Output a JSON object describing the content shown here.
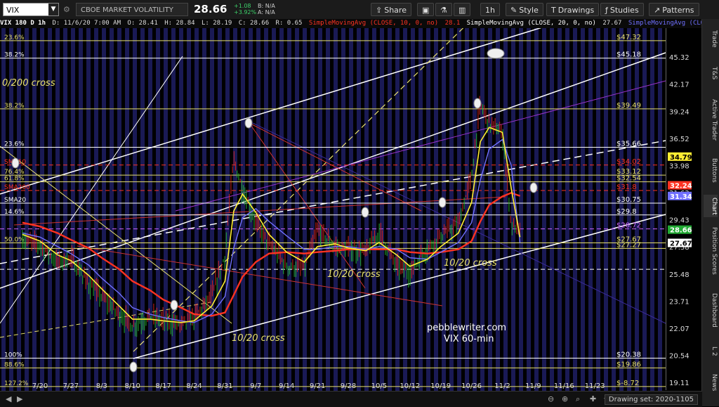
{
  "toolbar": {
    "symbol": "VIX",
    "description": "CBOE MARKET VOLATILITY INDEX",
    "last": "28.66",
    "change": "+1.08",
    "change_pct": "+3.92%",
    "bid": "B: N/A",
    "ask": "A: N/A",
    "share_label": "Share",
    "timeframe": "1h",
    "style_label": "Style",
    "drawings_label": "Drawings",
    "studies_label": "Studies",
    "patterns_label": "Patterns"
  },
  "status_line": {
    "title": "VIX 180 D 1h",
    "date": "D: 11/6/20 7:00 AM",
    "open": "O: 28.41",
    "high": "H: 28.84",
    "low": "L: 28.19",
    "close": "C: 28.66",
    "range": "R: 0.65",
    "sma1": "SimpleMovingAvg (CLOSE, 10, 0, no)",
    "sma1_val": "28.1",
    "sma2": "SimpleMovingAvg (CLOSE, 20, 0, no)",
    "sma2_val": "27.67",
    "sma3": "SimpleMovingAvg (CLOSE, 50,"
  },
  "right_tabs": [
    "Trade",
    "T&S",
    "Active Trader",
    "Buttons",
    "Chart",
    "Position Scores",
    "Dashboard",
    "L 2",
    "News"
  ],
  "drawing_set": "Drawing set: 2020-1105",
  "colors": {
    "background": "#000000",
    "band": "#1a1a55",
    "candle_up": "#22aa33",
    "candle_down": "#cc2222",
    "sma10": "#ffee33",
    "sma20": "#7070ff",
    "sma50": "#ff3322",
    "fib": "#e8e070"
  },
  "chart_data": {
    "type": "line",
    "title": "",
    "ylim": [
      19.11,
      48.2
    ],
    "y_ticks": [
      "45.32",
      "42.17",
      "39.24",
      "36.52",
      "33.98",
      "31.63",
      "29.43",
      "27.38",
      "25.48",
      "23.71",
      "22.07",
      "20.54",
      "19.11"
    ],
    "x_ticks": [
      "7/20",
      "7/27",
      "8/3",
      "8/10",
      "8/17",
      "8/24",
      "8/31",
      "9/7",
      "9/14",
      "9/21",
      "9/28",
      "10/5",
      "10/12",
      "10/19",
      "10/26",
      "11/2",
      "11/9",
      "11/16",
      "11/23"
    ],
    "series": [
      {
        "name": "VIX",
        "x": [
          "7/16",
          "7/20",
          "7/24",
          "7/27",
          "7/31",
          "8/3",
          "8/7",
          "8/10",
          "8/14",
          "8/17",
          "8/21",
          "8/24",
          "8/28",
          "8/31",
          "9/2",
          "9/4",
          "9/7",
          "9/10",
          "9/14",
          "9/18",
          "9/21",
          "9/25",
          "9/28",
          "10/2",
          "10/5",
          "10/9",
          "10/12",
          "10/16",
          "10/19",
          "10/23",
          "10/26",
          "10/28",
          "10/30",
          "11/2",
          "11/4",
          "11/6"
        ],
        "values": [
          28.0,
          27.5,
          26.3,
          26.6,
          24.8,
          24.0,
          22.9,
          22.2,
          22.8,
          22.5,
          22.3,
          22.7,
          24.0,
          26.7,
          34.5,
          31.8,
          29.2,
          27.6,
          26.0,
          25.9,
          28.6,
          27.4,
          27.2,
          27.0,
          28.5,
          26.0,
          25.6,
          27.3,
          28.2,
          29.1,
          33.0,
          40.0,
          38.0,
          37.0,
          29.0,
          28.66
        ]
      },
      {
        "name": "SMA10",
        "values": [
          28.3,
          27.8,
          26.8,
          26.4,
          25.4,
          24.5,
          23.4,
          22.6,
          22.6,
          22.5,
          22.4,
          22.5,
          23.4,
          25.0,
          30.1,
          31.5,
          30.0,
          28.3,
          27.0,
          26.3,
          27.4,
          27.6,
          27.3,
          27.1,
          27.7,
          26.8,
          26.0,
          26.5,
          27.4,
          28.4,
          30.8,
          36.2,
          37.6,
          37.1,
          32.0,
          28.1
        ]
      },
      {
        "name": "SMA20",
        "values": [
          28.4,
          28.1,
          27.4,
          26.9,
          26.1,
          25.2,
          24.2,
          23.3,
          22.9,
          22.7,
          22.5,
          22.4,
          22.9,
          24.0,
          27.3,
          29.6,
          30.3,
          29.3,
          28.2,
          27.2,
          27.2,
          27.4,
          27.4,
          27.2,
          27.4,
          27.2,
          26.6,
          26.5,
          27.0,
          27.7,
          29.2,
          32.7,
          35.5,
          36.4,
          34.0,
          27.67
        ]
      },
      {
        "name": "SMA50",
        "values": [
          29.2,
          28.9,
          28.4,
          27.9,
          27.3,
          26.6,
          25.8,
          25.0,
          24.4,
          23.8,
          23.3,
          22.9,
          22.8,
          23.0,
          24.1,
          25.3,
          26.3,
          26.9,
          27.0,
          26.9,
          27.0,
          27.1,
          27.2,
          27.2,
          27.2,
          27.2,
          27.0,
          26.9,
          27.0,
          27.2,
          27.8,
          29.3,
          30.6,
          31.3,
          31.6,
          31.34
        ]
      }
    ],
    "price_labels": [
      {
        "text": "34.79",
        "value": 34.79,
        "bg": "#ffee33",
        "fg": "#000000"
      },
      {
        "text": "32.24",
        "value": 32.24,
        "bg": "#ff3322",
        "fg": "#ffffff"
      },
      {
        "text": "31.34",
        "value": 31.34,
        "bg": "#7070ff",
        "fg": "#ffffff"
      },
      {
        "text": "28.66",
        "value": 28.66,
        "bg": "#22aa33",
        "fg": "#ffffff"
      },
      {
        "text": "27.67",
        "value": 27.67,
        "bg": "#ffffff",
        "fg": "#000000"
      }
    ],
    "levels": [
      {
        "value": 47.32,
        "left": "23.6%",
        "right": "$47.32",
        "color": "#e8e070",
        "dash": false
      },
      {
        "value": 45.18,
        "left": "38.2%",
        "right": "$45.18",
        "color": "#ffffff",
        "dash": false
      },
      {
        "value": 39.49,
        "left": "38.2%",
        "right": "$39.49",
        "color": "#e8e070",
        "dash": false
      },
      {
        "value": 35.66,
        "left": "23.6%",
        "right": "$35.66",
        "color": "#ffffff",
        "dash": false
      },
      {
        "value": 34.02,
        "left": "SMA10",
        "right": "$34.02",
        "color": "#ff3322",
        "dash": true
      },
      {
        "value": 33.12,
        "left": "76.4%",
        "right": "$33.12",
        "color": "#e8e070",
        "dash": false
      },
      {
        "value": 32.54,
        "left": "61.8%",
        "right": "$32.54",
        "color": "#e8e070",
        "dash": false
      },
      {
        "value": 31.8,
        "left": "SMA200",
        "right": "$31.8",
        "color": "#ff3322",
        "dash": true
      },
      {
        "value": 30.75,
        "left": "SMA20",
        "right": "$30.75",
        "color": "#ffffff",
        "dash": false
      },
      {
        "value": 29.8,
        "left": "14.6%",
        "right": "$29.8",
        "color": "#ffffff",
        "dash": false
      },
      {
        "value": 28.72,
        "left": "",
        "right": "$28.72",
        "color": "#cc66ff",
        "dash": true
      },
      {
        "value": 27.67,
        "left": "50.0%",
        "right": "$27.67",
        "color": "#e8e070",
        "dash": false
      },
      {
        "value": 27.27,
        "left": "",
        "right": "$27.27",
        "color": "#e8e070",
        "dash": false
      },
      {
        "value": 25.8,
        "left": "",
        "right": "",
        "color": "#ffffff",
        "dash": true
      },
      {
        "value": 20.38,
        "left": "100%",
        "right": "$20.38",
        "color": "#ffffff",
        "dash": false
      },
      {
        "value": 19.86,
        "left": "88.6%",
        "right": "$19.86",
        "color": "#e8e070",
        "dash": false
      },
      {
        "value": 18.9,
        "left": "127.2%",
        "right": "$-8.72",
        "color": "#e8e070",
        "dash": false
      }
    ],
    "annotations": [
      {
        "text": "0/200 cross",
        "color": "#e8e070"
      },
      {
        "text": "10/20 cross",
        "color": "#e8e070"
      },
      {
        "text": "10/20 cross",
        "color": "#e8e070"
      },
      {
        "text": "10/20 cross",
        "color": "#e8e070"
      },
      {
        "text": "pebblewriter.com",
        "color": "#ffffff"
      },
      {
        "text": "VIX 60-min",
        "color": "#ffffff"
      }
    ]
  }
}
